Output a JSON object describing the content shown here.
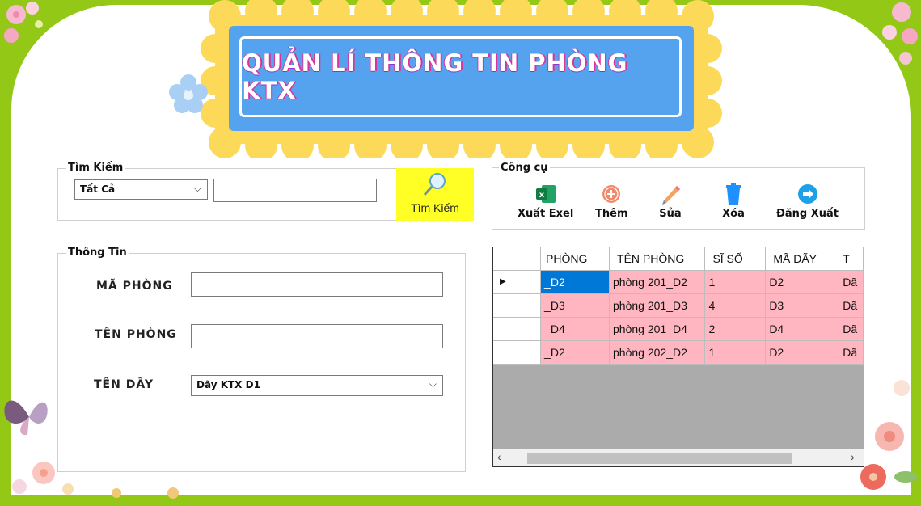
{
  "title": "QUẢN LÍ THÔNG TIN PHÒNG KTX",
  "search_group": {
    "legend": "Tìm Kiếm",
    "filter_selected": "Tất Cả",
    "search_value": "",
    "search_button_label": "Tìm Kiếm"
  },
  "tools_group": {
    "legend": "Công cụ",
    "buttons": [
      {
        "label": "Xuất Exel",
        "icon": "excel-icon"
      },
      {
        "label": "Thêm",
        "icon": "add-icon"
      },
      {
        "label": "Sửa",
        "icon": "pencil-icon"
      },
      {
        "label": "Xóa",
        "icon": "trash-icon"
      },
      {
        "label": "Đăng Xuất",
        "icon": "logout-icon"
      }
    ]
  },
  "info_group": {
    "legend": "Thông Tin",
    "ma_phong_label": "MÃ PHÒNG",
    "ma_phong_value": "",
    "ten_phong_label": "TÊN PHÒNG",
    "ten_phong_value": "",
    "ten_day_label": "TÊN DÃY",
    "ten_day_selected": "Dãy KTX D1"
  },
  "table": {
    "columns": [
      "PHÒNG",
      "TÊN PHÒNG",
      "SĨ SỐ",
      "MÃ DÃY",
      "T"
    ],
    "rows": [
      [
        "_D2",
        "phòng 201_D2",
        "1",
        "D2",
        "Dã"
      ],
      [
        "_D3",
        "phòng 201_D3",
        "4",
        "D3",
        "Dã"
      ],
      [
        "_D4",
        "phòng 201_D4",
        "2",
        "D4",
        "Dã"
      ],
      [
        "_D2",
        "phòng 202_D2",
        "1",
        "D2",
        "Dã"
      ]
    ],
    "row_fill_color": "#ffb6c1",
    "selected_color": "#0078d7"
  },
  "colors": {
    "background_green": "#93c816",
    "title_blue": "#55a3ef",
    "scallop_yellow": "#fdd95a",
    "search_button_yellow": "#ffff26"
  }
}
